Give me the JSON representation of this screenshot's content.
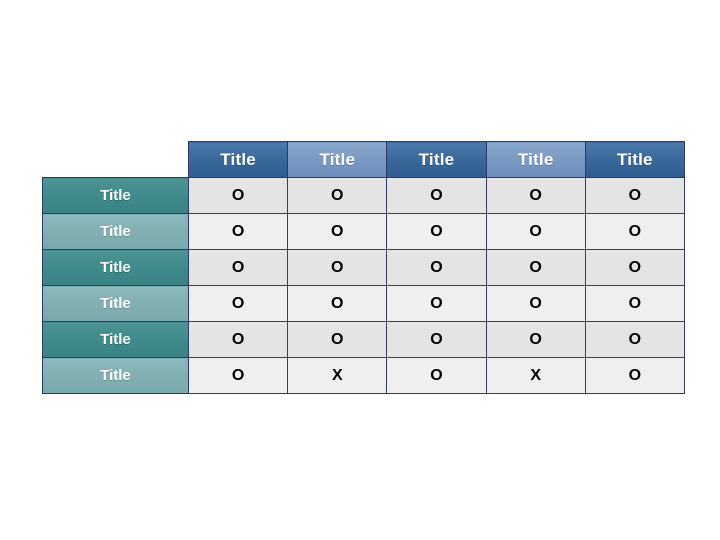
{
  "slide": {
    "background_color": "#ffffff"
  },
  "table": {
    "corner_label": "",
    "column_headers": [
      {
        "label": "Title",
        "tone": "dark"
      },
      {
        "label": "Title",
        "tone": "light"
      },
      {
        "label": "Title",
        "tone": "dark"
      },
      {
        "label": "Title",
        "tone": "light"
      },
      {
        "label": "Title",
        "tone": "dark"
      }
    ],
    "rows": [
      {
        "label": "Title",
        "tone": "teal-dark",
        "shade": "shade-a",
        "cells": [
          "O",
          "O",
          "O",
          "O",
          "O"
        ]
      },
      {
        "label": "Title",
        "tone": "teal-light",
        "shade": "shade-b",
        "cells": [
          "O",
          "O",
          "O",
          "O",
          "O"
        ]
      },
      {
        "label": "Title",
        "tone": "teal-dark",
        "shade": "shade-a",
        "cells": [
          "O",
          "O",
          "O",
          "O",
          "O"
        ]
      },
      {
        "label": "Title",
        "tone": "teal-light",
        "shade": "shade-b",
        "cells": [
          "O",
          "O",
          "O",
          "O",
          "O"
        ]
      },
      {
        "label": "Title",
        "tone": "teal-dark",
        "shade": "shade-a",
        "cells": [
          "O",
          "O",
          "O",
          "O",
          "O"
        ]
      },
      {
        "label": "Title",
        "tone": "teal-light",
        "shade": "shade-b",
        "cells": [
          "O",
          "X",
          "O",
          "X",
          "O"
        ]
      }
    ],
    "colors": {
      "header_dark": "#3c6a9c",
      "header_light": "#7c9bc4",
      "label_dark": "#3f8a8b",
      "label_light": "#81afb2",
      "cell_shade_a": "#e4e4e4",
      "cell_shade_b": "#efefef",
      "border": "#343c6e",
      "header_text": "#ffffff",
      "cell_text": "#000000"
    }
  }
}
